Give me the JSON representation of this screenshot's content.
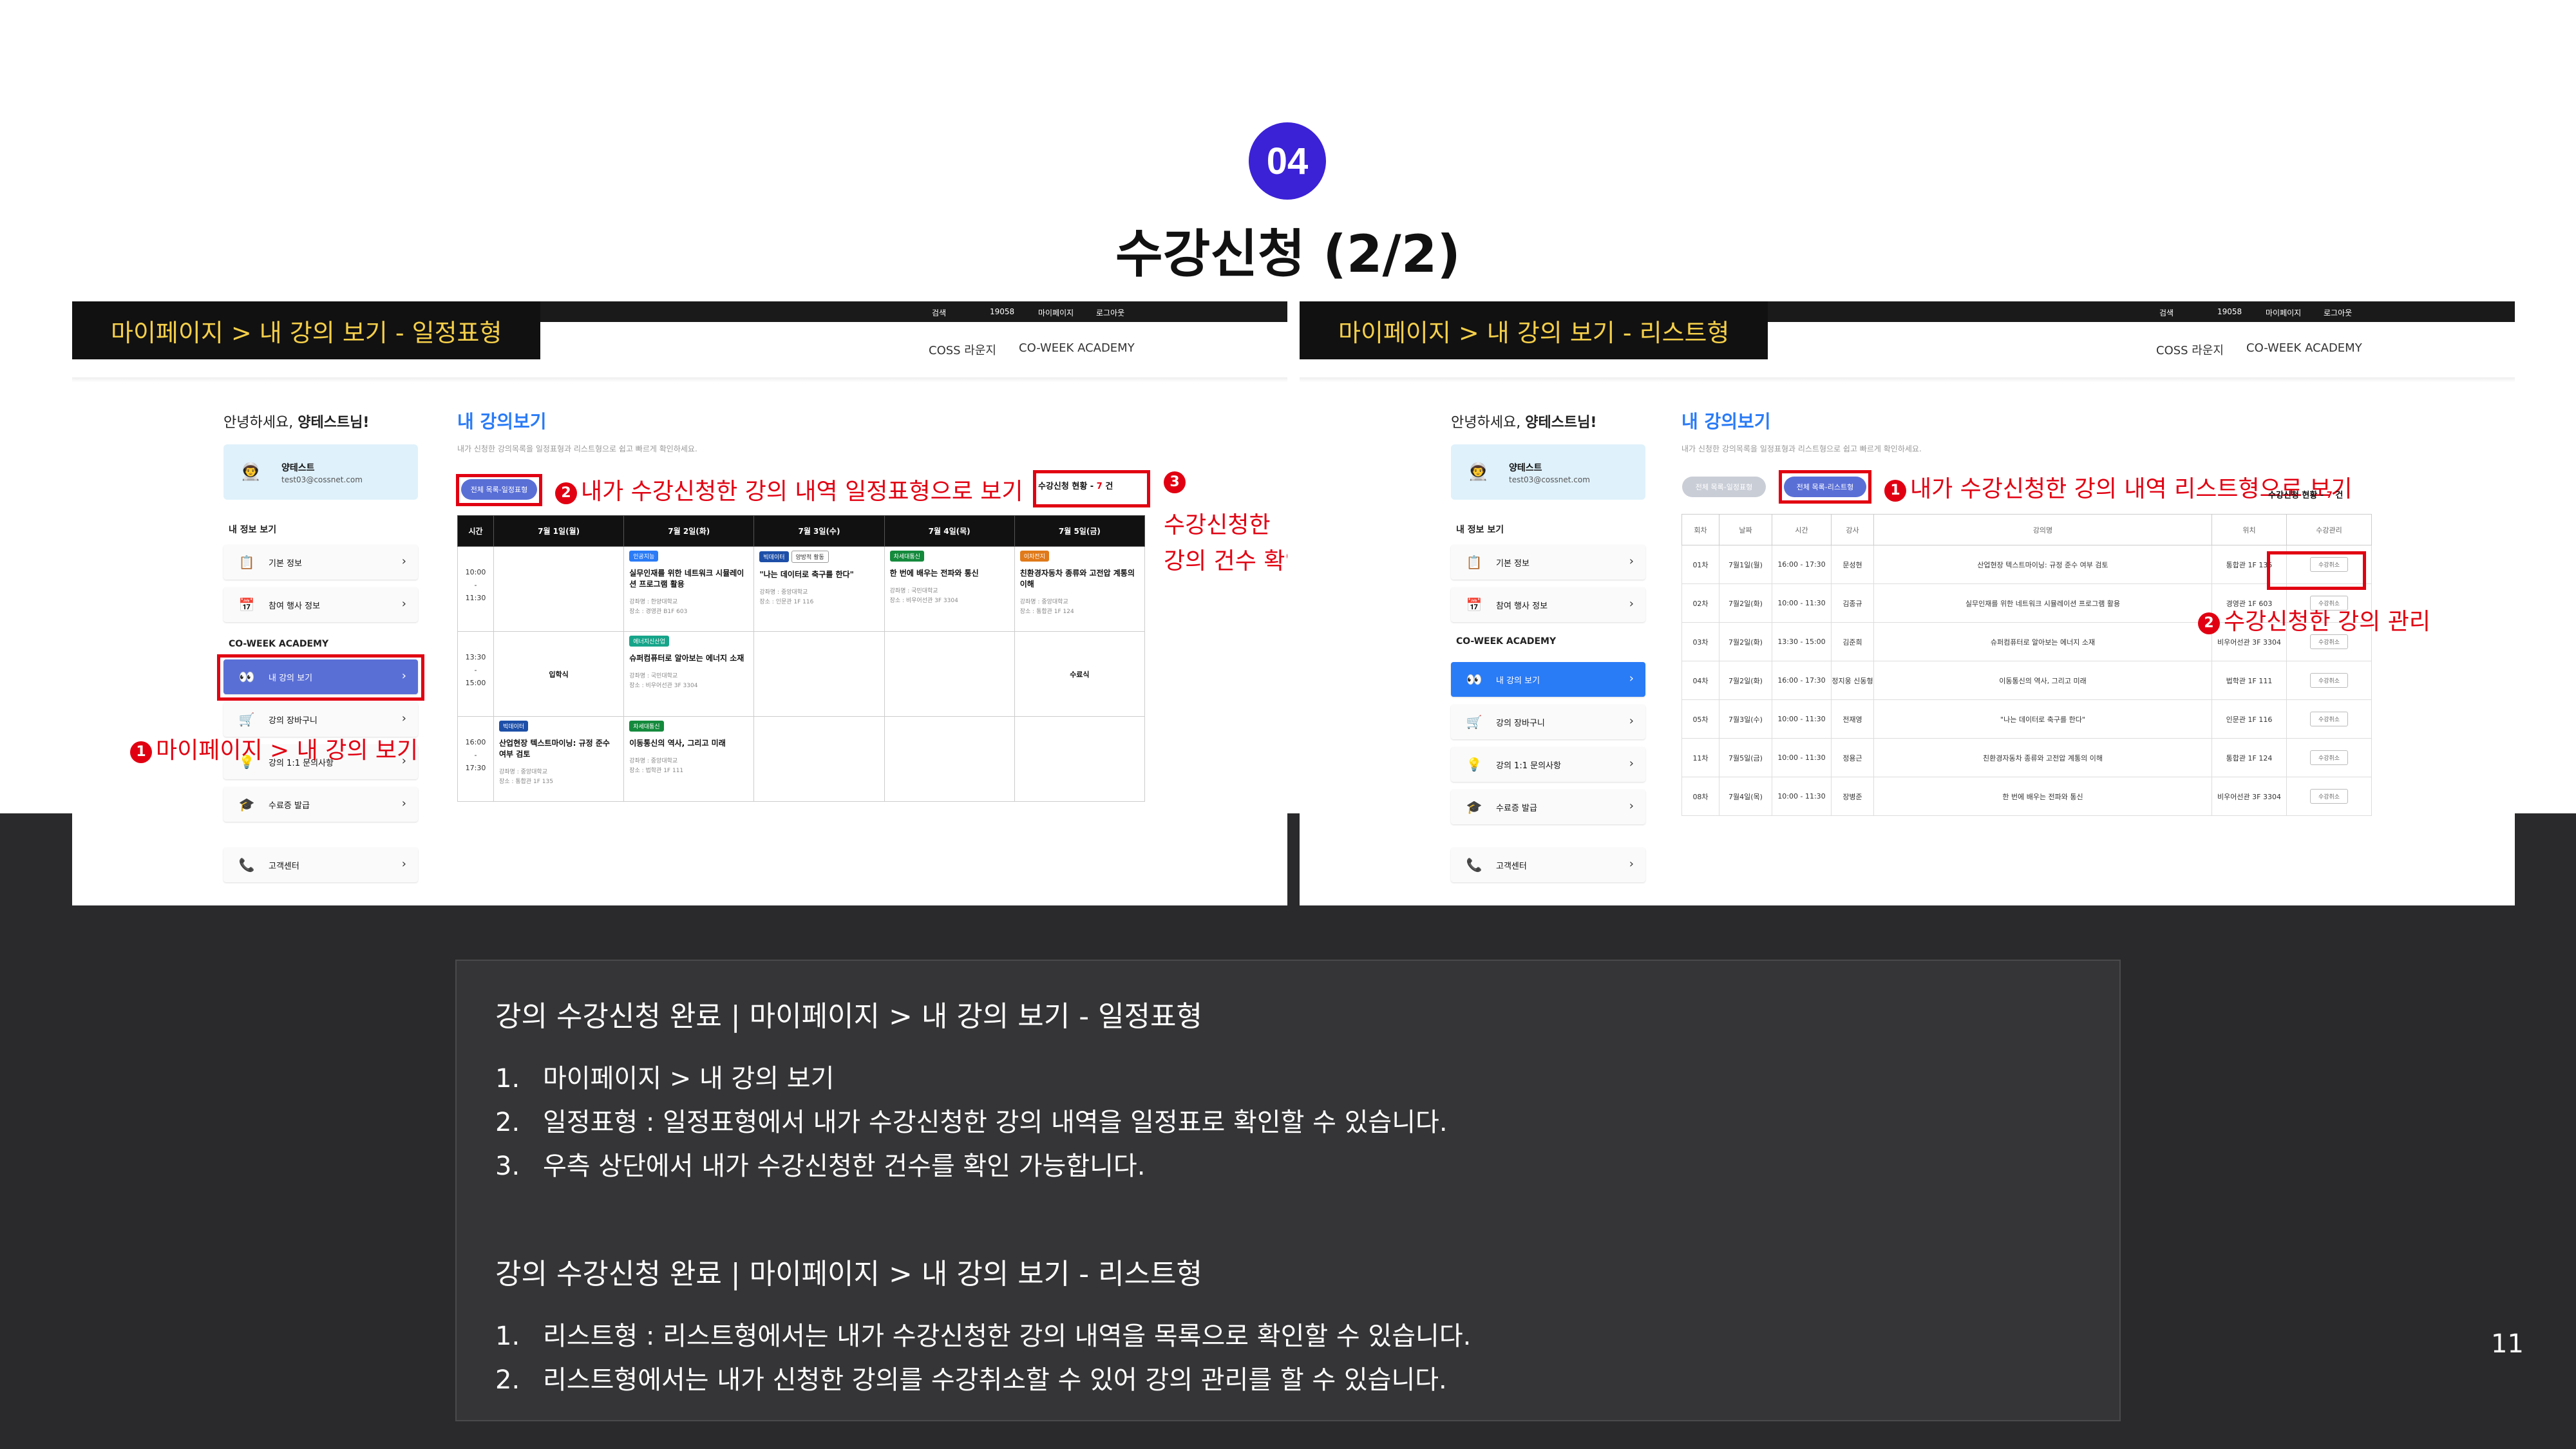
{
  "slide": {
    "badge": "04",
    "title": "수강신청 (2/2)",
    "page_number": "11"
  },
  "topbar": {
    "search": "검색",
    "phone": "19058",
    "mypage": "마이페이지",
    "logout": "로그아웃"
  },
  "nav": {
    "coss": "COSS 라운지",
    "coweek": "CO-WEEK ACADEMY"
  },
  "left": {
    "crumb": "마이페이지 > 내 강의 보기 - 일정표형",
    "hello": "안녕하세요,",
    "hello_name": "양테스트님!",
    "profile": {
      "name": "양테스트",
      "email": "test03@cossnet.com"
    },
    "section_my": "내 정보 보기",
    "menu": [
      {
        "label": "기본 정보"
      },
      {
        "label": "참여 행사 정보"
      }
    ],
    "section_academy": "CO-WEEK ACADEMY",
    "academy": [
      {
        "label": "내 강의 보기"
      },
      {
        "label": "강의 장바구니"
      },
      {
        "label": "강의 1:1 문의사항"
      },
      {
        "label": "수료증 발급"
      }
    ],
    "support": "고객센터",
    "page_title": "내 강의보기",
    "page_sub": "내가 신청한 강의목록을 일정표형과 리스트형으로 쉽고 빠르게 확인하세요.",
    "tab_active": "전체 목록-일정표형",
    "count_label": "수강신청 현황 -",
    "count_value": "7",
    "count_unit": "건",
    "note1": "마이페이지 > 내 강의 보기",
    "note2": "내가 수강신청한 강의 내역 일정표형으로 보기",
    "note3a": "수강신청한",
    "note3b": "강의 건수 확인",
    "num1": "1",
    "num2": "2",
    "num3": "3",
    "schedule": {
      "time_header": "시간",
      "days": [
        "7월 1일(월)",
        "7월 2일(화)",
        "7월 3일(수)",
        "7월 4일(목)",
        "7월 5일(금)"
      ],
      "slots": [
        {
          "start": "10:00",
          "end": "11:30"
        },
        {
          "start": "13:30",
          "end": "15:00"
        },
        {
          "start": "16:00",
          "end": "17:30"
        }
      ],
      "row1": [
        {
          "tag": "인공지능",
          "title": "실무인재를 위한 네트워크 시뮬레이션 프로그램 활용",
          "meta1": "강좌명 : 한양대학교",
          "meta2": "장소 : 경영관 B1F 603"
        },
        {
          "tag": "빅데이터",
          "tag2": "양방적 활동",
          "title": "\"나는 데이터로 축구를 한다\"",
          "meta1": "강좌명 : 중앙대학교",
          "meta2": "장소 : 인문관 1F 116"
        },
        {
          "tag": "차세대통신",
          "title": "한 번에 배우는 전파와 통신",
          "meta1": "강좌명 : 국민대학교",
          "meta2": "장소 : 비우어선관 3F 3304"
        },
        {
          "tag": "이차전지",
          "title": "친환경자동차 종류와 고전압 계통의 이해",
          "meta1": "강좌명 : 중앙대학교",
          "meta2": "장소 : 통합관 1F 124"
        }
      ],
      "row2": {
        "opening": "입학식",
        "closing": "수료식",
        "event": {
          "tag": "에너지신산업",
          "title": "슈퍼컴퓨터로 알아보는 에너지 소재",
          "meta1": "강좌명 : 국민대학교",
          "meta2": "장소 : 비우어선관 3F 3304"
        }
      },
      "row3": [
        {
          "tag": "빅데이터",
          "title": "산업현장 텍스트마이닝: 규정 준수 여부 검토",
          "meta1": "강좌명 : 중앙대학교",
          "meta2": "장소 : 통합관 1F 135"
        },
        {
          "tag": "차세대통신",
          "title": "이동통신의 역사, 그리고 미래",
          "meta1": "강좌명 : 중앙대학교",
          "meta2": "장소 : 법학관 1F 111"
        }
      ]
    }
  },
  "right": {
    "crumb": "마이페이지 > 내 강의 보기 - 리스트형",
    "tab_inactive": "전체 목록-일정표형",
    "tab_active": "전체 목록-리스트형",
    "note1": "내가 수강신청한 강의 내역 리스트형으로 보기",
    "note2": "수강신청한 강의 관리",
    "count_label": "수강신청 현황 -",
    "count_value": "7",
    "count_unit": "건",
    "columns": [
      "회차",
      "날짜",
      "시간",
      "강사",
      "강의명",
      "위치",
      "수강관리"
    ],
    "rows": [
      [
        "01차",
        "7월1일(월)",
        "16:00 - 17:30",
        "문성현",
        "산업현장 텍스트마이닝: 규정 준수 여부 검토",
        "통합관 1F 135"
      ],
      [
        "02차",
        "7월2일(화)",
        "10:00 - 11:30",
        "김종규",
        "실무인재를 위한 네트워크 시뮬레이션 프로그램 활용",
        "경영관 1F 603"
      ],
      [
        "03차",
        "7월2일(화)",
        "13:30 - 15:00",
        "김준희",
        "슈퍼컴퓨터로 알아보는 에너지 소재",
        "비우어선관 3F 3304"
      ],
      [
        "04차",
        "7월2일(화)",
        "16:00 - 17:30",
        "정지웅 신동형",
        "이동통신의 역사, 그리고 미래",
        "법학관 1F 111"
      ],
      [
        "05차",
        "7월3일(수)",
        "10:00 - 11:30",
        "전재영",
        "\"나는 데이터로 축구를 한다\"",
        "인문관 1F 116"
      ],
      [
        "11차",
        "7월5일(금)",
        "10:00 - 11:30",
        "정용근",
        "친환경자동차 종류와 고전압 계통의 이해",
        "통합관 1F 124"
      ],
      [
        "08차",
        "7월4일(목)",
        "10:00 - 11:30",
        "장병준",
        "한 번에 배우는 전파와 통신",
        "비우어선관 3F 3304"
      ]
    ],
    "cancel": "수강취소"
  },
  "info": {
    "section1": "강의 수강신청 완료 | 마이페이지 > 내 강의 보기 - 일정표형",
    "items1": [
      {
        "n": "1.",
        "t": "마이페이지 > 내 강의 보기"
      },
      {
        "n": "2.",
        "t": "일정표형 : 일정표형에서 내가 수강신청한 강의 내역을 일정표로 확인할 수 있습니다."
      },
      {
        "n": "3.",
        "t": "우측 상단에서 내가 수강신청한 건수를 확인 가능합니다."
      }
    ],
    "section2": "강의 수강신청 완료 | 마이페이지 > 내 강의 보기 - 리스트형",
    "items2": [
      {
        "n": "1.",
        "t": "리스트형 : 리스트형에서는 내가 수강신청한 강의 내역을 목록으로 확인할 수 있습니다."
      },
      {
        "n": "2.",
        "t": "리스트형에서는 내가 신청한 강의를 수강취소할 수 있어 강의 관리를 할 수 있습니다."
      }
    ]
  }
}
